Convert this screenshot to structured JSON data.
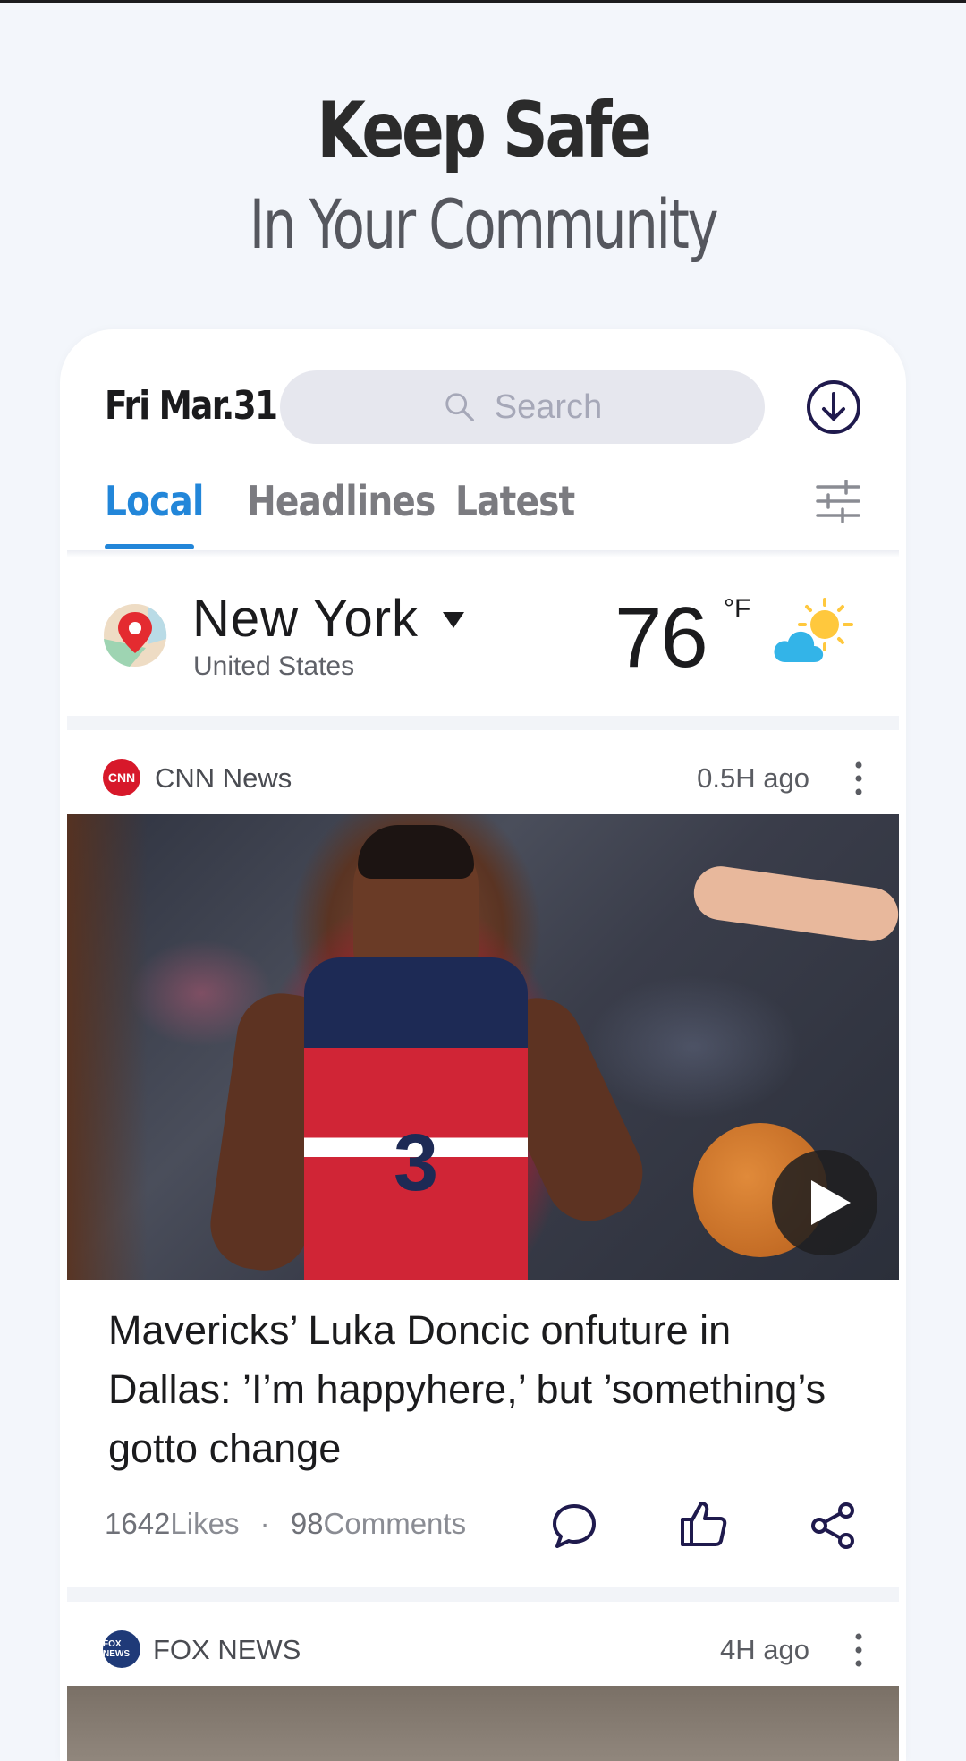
{
  "promo": {
    "title": "Keep Safe",
    "subtitle": "In Your Community"
  },
  "header": {
    "date": "Fri Mar.31",
    "search_placeholder": "Search"
  },
  "tabs": [
    {
      "label": "Local",
      "active": true
    },
    {
      "label": "Headlines",
      "active": false
    },
    {
      "label": "Latest",
      "active": false
    }
  ],
  "location": {
    "city": "New York",
    "country": "United States"
  },
  "weather": {
    "temperature": "76",
    "unit": "°F",
    "condition_icon": "partly-sunny-icon"
  },
  "feed": [
    {
      "source": "CNN News",
      "source_logo": "CNN",
      "time_ago": "0.5H ago",
      "has_video": true,
      "headline": "Mavericks’ Luka Doncic onfuture in Dallas: ’I’m happyhere,’ but ’something’s gotto change",
      "likes": "1642",
      "likes_label": "Likes",
      "separator": "·",
      "comments": "98",
      "comments_label": "Comments"
    },
    {
      "source": "FOX NEWS",
      "source_logo": "FOX NEWS",
      "time_ago": "4H ago"
    }
  ],
  "colors": {
    "accent": "#2286d9",
    "navy": "#1f1a4d",
    "cnn_red": "#d7182a"
  }
}
